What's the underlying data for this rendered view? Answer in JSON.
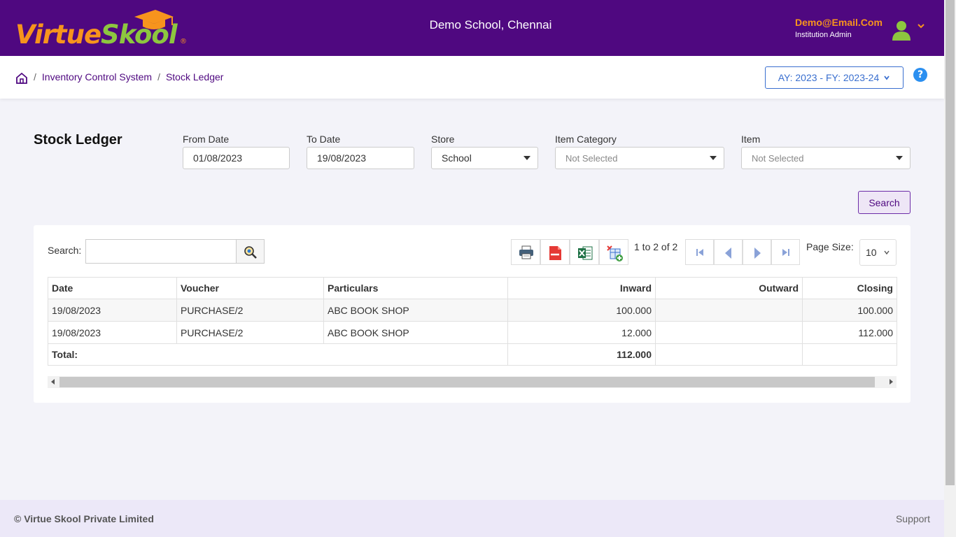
{
  "header": {
    "logo_part1": "Virtue",
    "logo_part2": "Skool",
    "logo_reg": "®",
    "school_name": "Demo School, Chennai",
    "user_email": "Demo@Email.Com",
    "user_role": "Institution Admin"
  },
  "breadcrumb": {
    "items": [
      "Inventory Control System",
      "Stock Ledger"
    ],
    "separator": "/"
  },
  "academic_year": "AY: 2023 - FY: 2023-24",
  "help_label": "?",
  "filters": {
    "title": "Stock Ledger",
    "from_date_label": "From Date",
    "from_date_value": "01/08/2023",
    "to_date_label": "To Date",
    "to_date_value": "19/08/2023",
    "store_label": "Store",
    "store_value": "School",
    "item_category_label": "Item Category",
    "item_category_value": "Not Selected",
    "item_label": "Item",
    "item_value": "Not Selected",
    "search_button": "Search"
  },
  "grid": {
    "search_label": "Search:",
    "search_value": "",
    "page_info": "1 to 2 of 2",
    "page_size_label": "Page Size:",
    "page_size_value": "10",
    "columns": [
      "Date",
      "Voucher",
      "Particulars",
      "Inward",
      "Outward",
      "Closing"
    ],
    "rows": [
      {
        "date": "19/08/2023",
        "voucher": "PURCHASE/2",
        "particulars": "ABC BOOK SHOP",
        "inward": "100.000",
        "outward": "",
        "closing": "100.000"
      },
      {
        "date": "19/08/2023",
        "voucher": "PURCHASE/2",
        "particulars": "ABC BOOK SHOP",
        "inward": "12.000",
        "outward": "",
        "closing": "112.000"
      }
    ],
    "total_label": "Total:",
    "total_inward": "112.000"
  },
  "footer": {
    "copyright": "© Virtue Skool Private Limited",
    "support": "Support"
  },
  "colors": {
    "header_bg": "#4f0880",
    "accent_orange": "#f7941d",
    "accent_green": "#8dc63f",
    "link_blue": "#3a6fcf"
  }
}
